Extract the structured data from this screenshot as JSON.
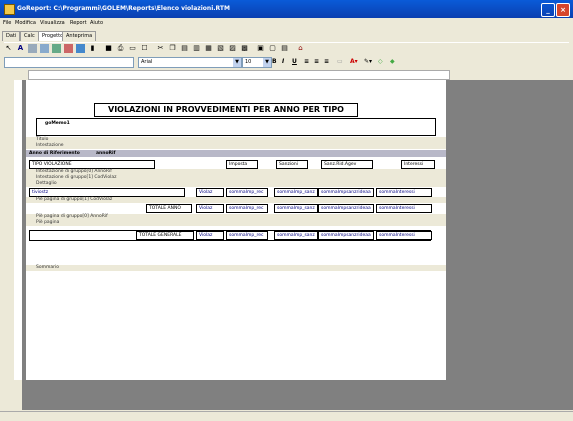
{
  "window": {
    "title": "GoReport: C:\\Programmi\\GOLEM\\Reports\\Elenco violazioni.RTM"
  },
  "menu": [
    "File",
    "Modifica",
    "Visualizza",
    "Report",
    "Aiuto"
  ],
  "tabs": [
    "Dati",
    "Calc",
    "Progetto",
    "Anteprima"
  ],
  "format": {
    "font": "Arial",
    "size": "10"
  },
  "report": {
    "title": "VIOLAZIONI IN PROVVEDIMENTI PER ANNO PER TIPO",
    "memo": "goMemo1",
    "bands": {
      "titolo": "Titolo",
      "intestazione": "Intestazione",
      "group0_header": "Intestazione di gruppo[0] AnnoRif",
      "group1_header": "Intestazione di gruppo[1] CodViolaz",
      "dettaglio": "Dettaglio",
      "group1_footer": "Piè pagina di gruppo[1] CodViolaz",
      "group0_footer": "Piè pagina di gruppo[0] AnnoRif",
      "page_footer": "Piè pagina",
      "sommario": "Sommario"
    },
    "anno_label": "Anno di Riferimento",
    "anno_field": "annoRif",
    "header_tipo": "TIPO VIOLAZIONE",
    "header_cols": [
      "Imposta",
      "Sanzioni",
      "Sanz.Rid.Agev",
      "Interessi"
    ],
    "detail_field": "tiviostz",
    "detail_fields": [
      "Violaz",
      "sommaImp_rec",
      "sommaImp_sanz",
      "sommaImpsanzrideaa",
      "sommaInteressi"
    ],
    "totale_anno": "TOTALE ANNO",
    "totale_generale": "TOTALE GENERALE"
  }
}
